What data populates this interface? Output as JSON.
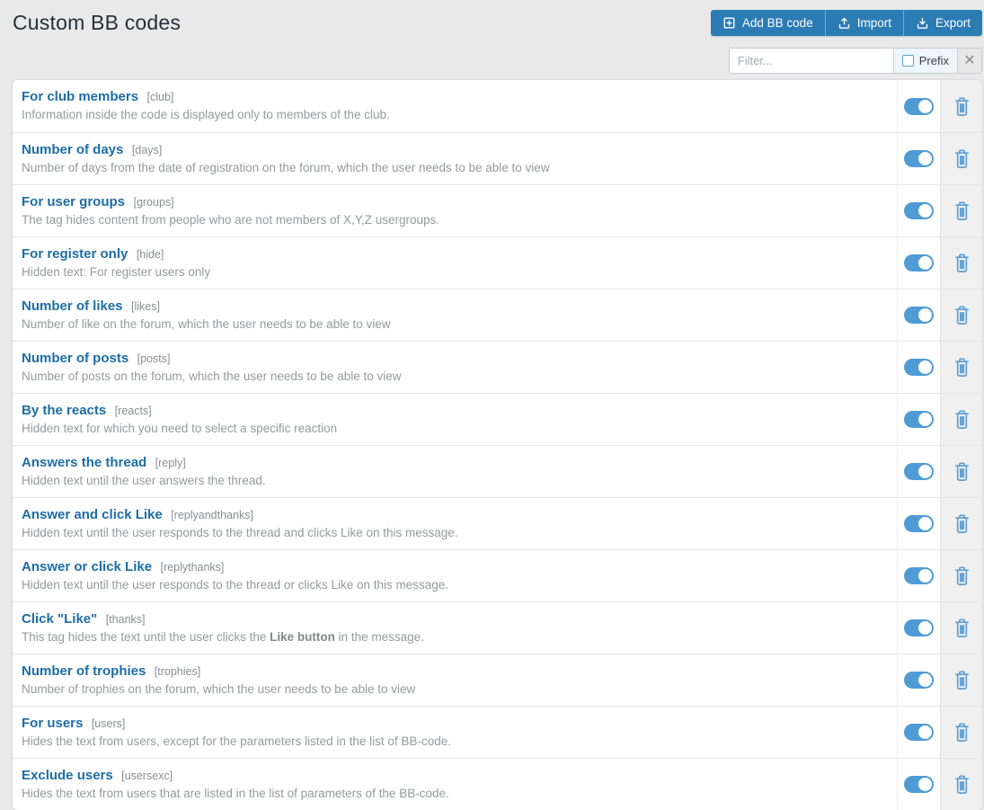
{
  "page": {
    "title": "Custom BB codes"
  },
  "toolbar": {
    "add_label": "Add BB code",
    "import_label": "Import",
    "export_label": "Export"
  },
  "filter": {
    "placeholder": "Filter...",
    "prefix_label": "Prefix",
    "clear_glyph": "✕"
  },
  "icons": {
    "add": "plus-square-icon",
    "import": "upload-icon",
    "export": "download-icon",
    "clear": "x-icon",
    "row_action": "trash-icon",
    "toggle": "toggle-switch"
  },
  "colors": {
    "accent_blue": "#2b7cb5",
    "toggle_blue": "#4f9bd5",
    "link_blue": "#1d6da6",
    "page_bg": "#e9e9e9"
  },
  "rows": [
    {
      "title": "For club members",
      "tag": "[club]",
      "description": "Information inside the code is displayed only to members of the club.",
      "enabled": true
    },
    {
      "title": "Number of days",
      "tag": "[days]",
      "description": "Number of days from the date of registration on the forum, which the user needs to be able to view",
      "enabled": true
    },
    {
      "title": "For user groups",
      "tag": "[groups]",
      "description": "The tag hides content from people who are not members of X,Y,Z usergroups.",
      "enabled": true
    },
    {
      "title": "For register only",
      "tag": "[hide]",
      "description": "Hidden text: For register users only",
      "enabled": true
    },
    {
      "title": "Number of likes",
      "tag": "[likes]",
      "description": "Number of like on the forum, which the user needs to be able to view",
      "enabled": true
    },
    {
      "title": "Number of posts",
      "tag": "[posts]",
      "description": "Number of posts on the forum, which the user needs to be able to view",
      "enabled": true
    },
    {
      "title": "By the reacts",
      "tag": "[reacts]",
      "description": "Hidden text for which you need to select a specific reaction",
      "enabled": true
    },
    {
      "title": "Answers the thread",
      "tag": "[reply]",
      "description": "Hidden text until the user answers the thread.",
      "enabled": true
    },
    {
      "title": "Answer and click Like",
      "tag": "[replyandthanks]",
      "description": "Hidden text until the user responds to the thread and clicks Like on this message.",
      "enabled": true
    },
    {
      "title": "Answer or click Like",
      "tag": "[replythanks]",
      "description": "Hidden text until the user responds to the thread or clicks Like on this message.",
      "enabled": true
    },
    {
      "title": "Click \"Like\"",
      "tag": "[thanks]",
      "description": "This tag hides the text until the user clicks the **Like button** in the message.",
      "enabled": true
    },
    {
      "title": "Number of trophies",
      "tag": "[trophies]",
      "description": "Number of trophies on the forum, which the user needs to be able to view",
      "enabled": true
    },
    {
      "title": "For users",
      "tag": "[users]",
      "description": "Hides the text from users, except for the parameters listed in the list of BB-code.",
      "enabled": true
    },
    {
      "title": "Exclude users",
      "tag": "[usersexc]",
      "description": "Hides the text from users that are listed in the list of parameters of the BB-code.",
      "enabled": true
    }
  ]
}
